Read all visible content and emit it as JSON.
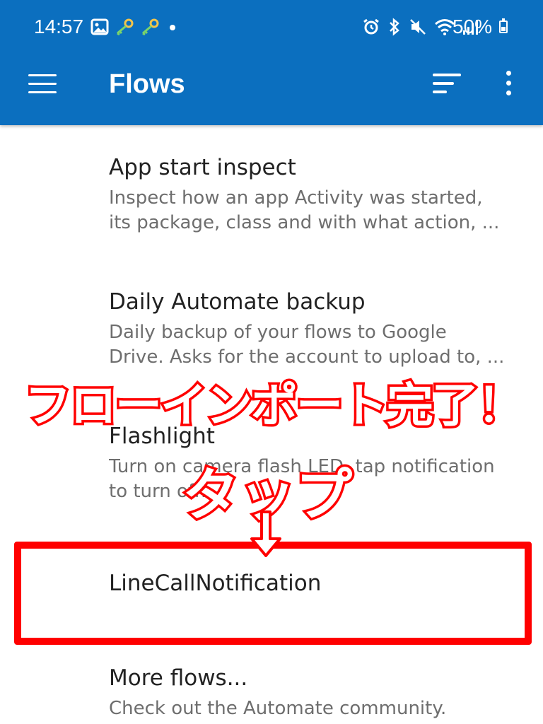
{
  "status_bar": {
    "time": "14:57",
    "battery": "50%",
    "battery_level": 0.5,
    "icons_left": [
      "gallery-icon",
      "key-icon",
      "key-icon",
      "dot-icon"
    ],
    "icons_right": [
      "alarm-icon",
      "bluetooth-icon",
      "mute-icon",
      "wifi-icon",
      "signal-icon"
    ]
  },
  "app_bar": {
    "title": "Flows",
    "icons": [
      "menu-icon",
      "sort-icon",
      "more-vert-icon"
    ]
  },
  "flows": [
    {
      "name": "App start inspect",
      "desc_lines": [
        "Inspect how an app Activity was started,",
        "its package, class and with what action, ..."
      ]
    },
    {
      "name": "Daily Automate backup",
      "desc_lines": [
        "Daily backup of your flows to Google",
        "Drive. Asks for the account to upload to, ..."
      ]
    },
    {
      "name": "Flashlight",
      "desc_lines": [
        "Turn on camera flash LED, tap notification",
        "to turn off."
      ]
    },
    {
      "name": "LineCallNotification",
      "desc_lines": []
    },
    {
      "name": "More flows...",
      "desc_lines": [
        "Check out the Automate community."
      ]
    }
  ],
  "overlay": {
    "headline": "フローインポート完了！",
    "tap_label": "タップ",
    "colors": {
      "stroke": "#ff0000",
      "fill": "#ffffff"
    }
  },
  "colors": {
    "app_bar": "#0b6fbf",
    "highlight": "#ff0000"
  }
}
